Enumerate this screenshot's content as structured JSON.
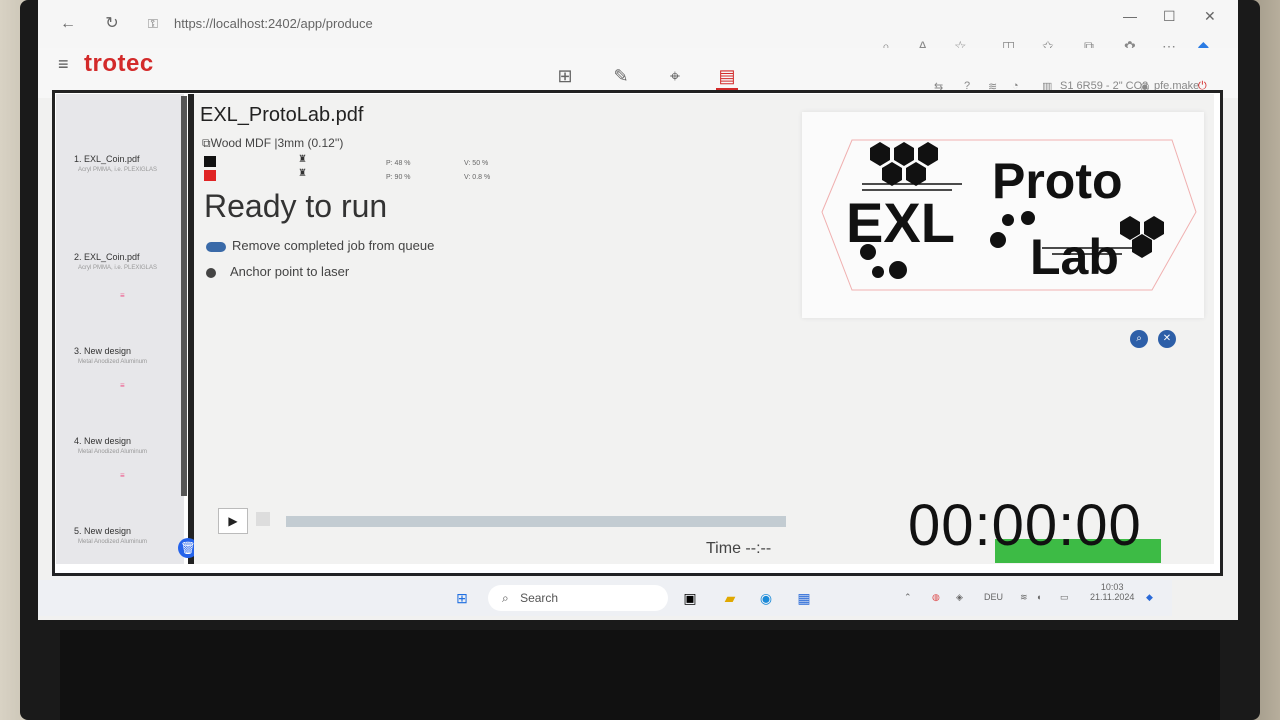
{
  "browser": {
    "url": "https://localhost:2402/app/produce"
  },
  "app": {
    "logo": "trotec",
    "header_right": {
      "machine": "S1 6R59 - 2\" CO2",
      "user": "pfe.make"
    }
  },
  "jobs": [
    {
      "title": "1. EXL_Coin.pdf",
      "sub": "Acryl PMMA, i.e. PLEXIGLAS"
    },
    {
      "title": "2. EXL_Coin.pdf",
      "sub": "Acryl PMMA, i.e. PLEXIGLAS"
    },
    {
      "title": "3. New design",
      "sub": "Metal Anodized Aluminum"
    },
    {
      "title": "4. New design",
      "sub": "Metal Anodized Aluminum"
    },
    {
      "title": "5. New design",
      "sub": "Metal Anodized Aluminum"
    }
  ],
  "job_detail": {
    "title": "EXL_ProtoLab.pdf",
    "material": "Wood MDF |3mm (0.12'')",
    "params": [
      {
        "p": "P: 48 %",
        "v": "V: 50 %",
        "color": "#111111"
      },
      {
        "p": "P: 90 %",
        "v": "V: 0.8 %",
        "color": "#e02424"
      }
    ],
    "status": "Ready to run",
    "option_remove": "Remove completed job from queue",
    "option_anchor": "Anchor point to laser"
  },
  "preview": {
    "logo_left": "EXL",
    "logo_right_1": "Proto",
    "logo_right_2": "Lab"
  },
  "playback": {
    "time_label": "Time --:--",
    "timer": "00:00:00"
  },
  "taskbar": {
    "search": "Search",
    "lang": "DEU",
    "clock_time": "10:03",
    "clock_date": "21.11.2024"
  }
}
